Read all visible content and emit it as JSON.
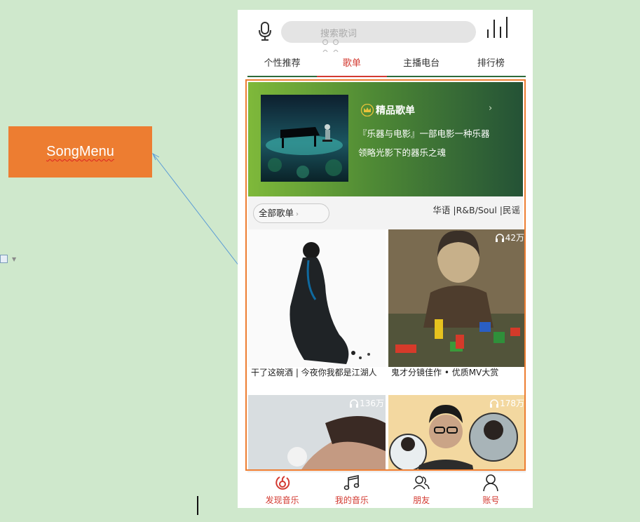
{
  "annotation": {
    "callout_label": "SongMenu"
  },
  "search": {
    "placeholder": "搜索歌词"
  },
  "tabs": [
    {
      "label": "个性推荐",
      "active": false
    },
    {
      "label": "歌单",
      "active": true
    },
    {
      "label": "主播电台",
      "active": false
    },
    {
      "label": "排行榜",
      "active": false
    }
  ],
  "banner": {
    "title": "精品歌单",
    "line1": "『乐器与电影』一部电影一种乐器",
    "line2": "领略光影下的器乐之魂"
  },
  "filter": {
    "all_label": "全部歌单",
    "genres": "华语 |R&B/Soul |民谣"
  },
  "playlists": [
    {
      "title": "干了这碗酒 | 今夜你我都是江湖人",
      "play_count": ""
    },
    {
      "title": "鬼才分镜佳作 • 优质MV大赏",
      "play_count": "42万"
    },
    {
      "title": "",
      "play_count": "136万"
    },
    {
      "title": "",
      "play_count": "178万"
    }
  ],
  "bottom_nav": [
    {
      "label": "发现音乐",
      "icon": "netease-logo-icon"
    },
    {
      "label": "我的音乐",
      "icon": "music-note-icon"
    },
    {
      "label": "朋友",
      "icon": "friends-icon"
    },
    {
      "label": "账号",
      "icon": "account-icon"
    }
  ],
  "colors": {
    "accent_red": "#d33a31",
    "callout_orange": "#ed7d31",
    "page_background": "#cfe8cc"
  }
}
